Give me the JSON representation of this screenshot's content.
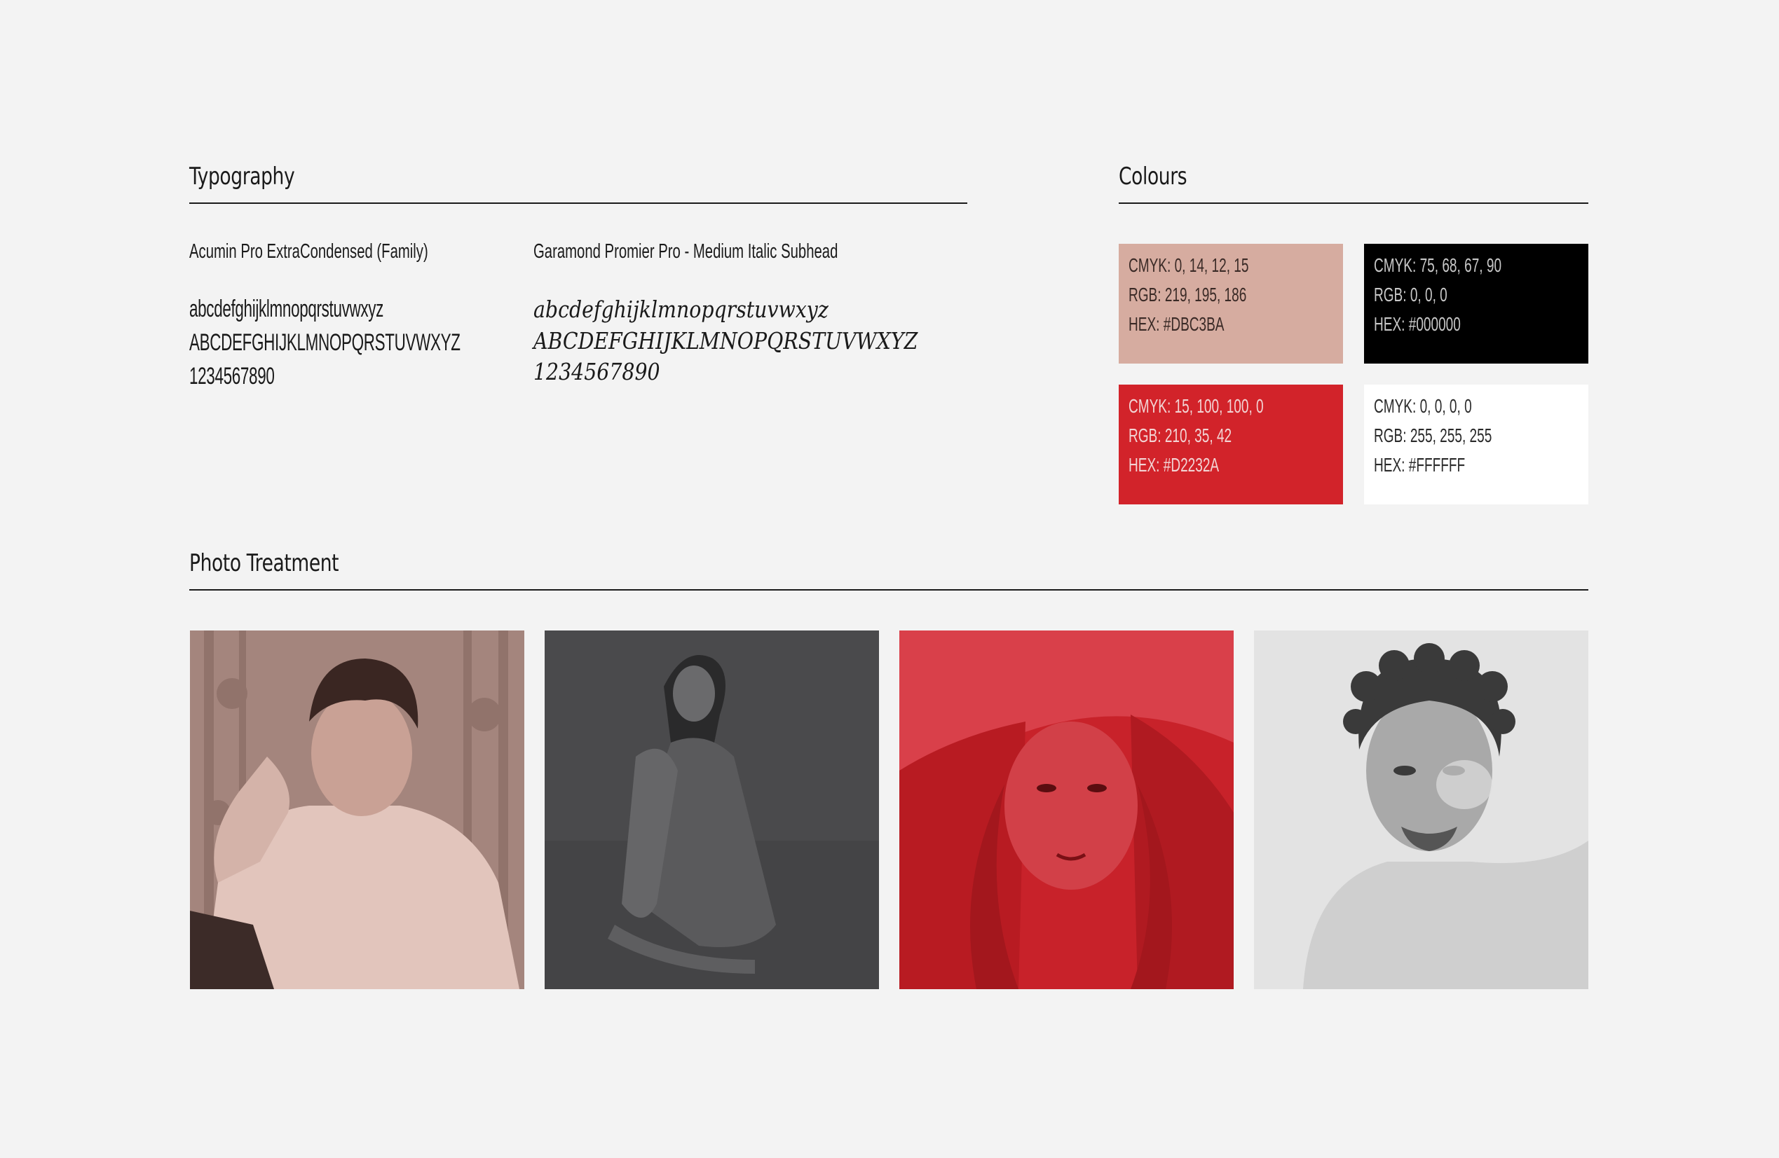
{
  "typography": {
    "title": "Typography",
    "fonts": [
      {
        "name": "Acumin Pro ExtraCondensed (Family)",
        "samples": [
          "abcdefghijklmnopqrstuvwxyz",
          "ABCDEFGHIJKLMNOPQRSTUVWXYZ",
          "1234567890"
        ]
      },
      {
        "name": "Garamond Promier Pro - Medium Italic Subhead",
        "samples": [
          "abcdefghijklmnopqrstuvwxyz",
          "ABCDEFGHIJKLMNOPQRSTUVWXYZ",
          "1234567890"
        ]
      }
    ]
  },
  "colours": {
    "title": "Colours",
    "swatches": [
      {
        "cmyk": "CMYK: 0, 14, 12, 15",
        "rgb": "RGB: 219, 195, 186",
        "hex": "HEX: #DBC3BA",
        "color": "#d6aca0",
        "text_color": "#3a2a26"
      },
      {
        "cmyk": "CMYK: 75, 68, 67, 90",
        "rgb": "RGB: 0, 0, 0",
        "hex": "HEX: #000000",
        "color": "#000000",
        "text_color": "#c8c8c8"
      },
      {
        "cmyk": "CMYK: 15, 100, 100, 0",
        "rgb": "RGB: 210, 35, 42",
        "hex": "HEX: #D2232A",
        "color": "#d2232a",
        "text_color": "#f2d4d4"
      },
      {
        "cmyk": "CMYK: 0, 0, 0, 0",
        "rgb": "RGB: 255, 255, 255",
        "hex": "HEX: #FFFFFF",
        "color": "#ffffff",
        "text_color": "#2a2a2a"
      }
    ]
  },
  "photo_treatment": {
    "title": "Photo Treatment",
    "photos": [
      {
        "subject": "man-in-sweater-portrait",
        "tint": "#a88a82"
      },
      {
        "subject": "seated-woman-portrait",
        "tint": "#4a4a4c"
      },
      {
        "subject": "woman-under-veil-portrait",
        "tint": "#c8222a"
      },
      {
        "subject": "man-with-curly-hair-portrait",
        "tint": "#dcdcdc"
      }
    ]
  }
}
